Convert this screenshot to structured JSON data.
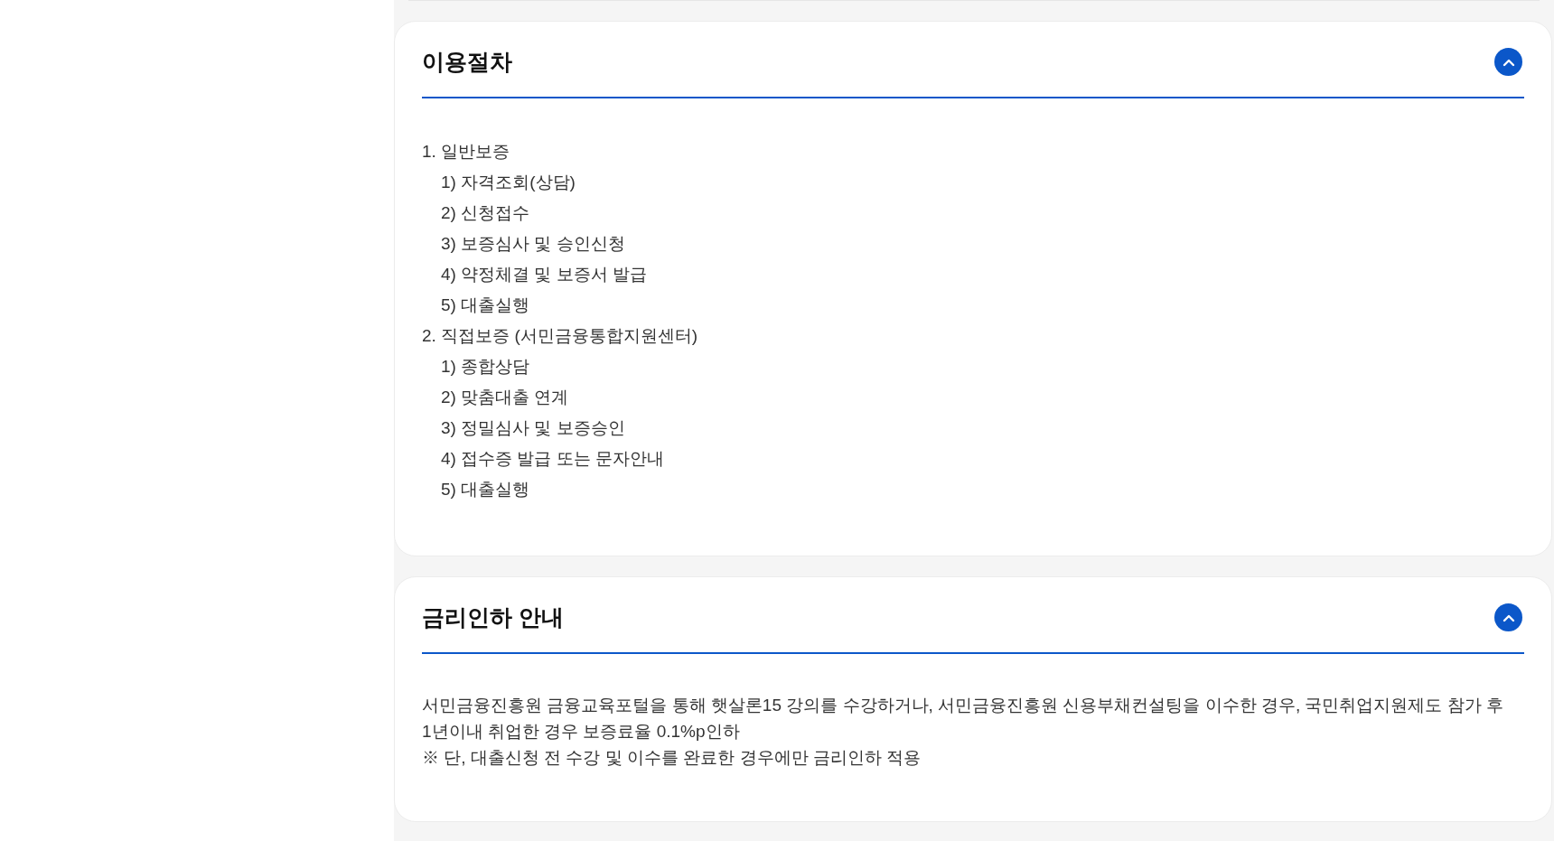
{
  "sections": [
    {
      "title": "이용절차",
      "expanded": true,
      "kind": "list",
      "items": [
        {
          "text": "1. 일반보증",
          "children": [
            {
              "text": "1) 자격조회(상담)"
            },
            {
              "text": "2) 신청접수"
            },
            {
              "text": "3) 보증심사 및 승인신청"
            },
            {
              "text": "4) 약정체결 및 보증서 발급"
            },
            {
              "text": "5) 대출실행"
            }
          ]
        },
        {
          "text": "2. 직접보증 (서민금융통합지원센터)",
          "children": [
            {
              "text": "1) 종합상담"
            },
            {
              "text": "2) 맞춤대출 연계"
            },
            {
              "text": "3) 정밀심사 및 보증승인"
            },
            {
              "text": "4) 접수증 발급 또는 문자안내"
            },
            {
              "text": "5) 대출실행"
            }
          ]
        }
      ]
    },
    {
      "title": "금리인하 안내",
      "expanded": true,
      "kind": "text",
      "lines": [
        "서민금융진흥원 금융교육포털을 통해 햇살론15 강의를 수강하거나, 서민금융진흥원 신용부채컨설팅을 이수한 경우, 국민취업지원제도 참가 후",
        "1년이내 취업한 경우 보증료율 0.1%p인하",
        "※ 단, 대출신청 전 수강 및 이수를 완료한 경우에만 금리인하 적용"
      ]
    }
  ]
}
